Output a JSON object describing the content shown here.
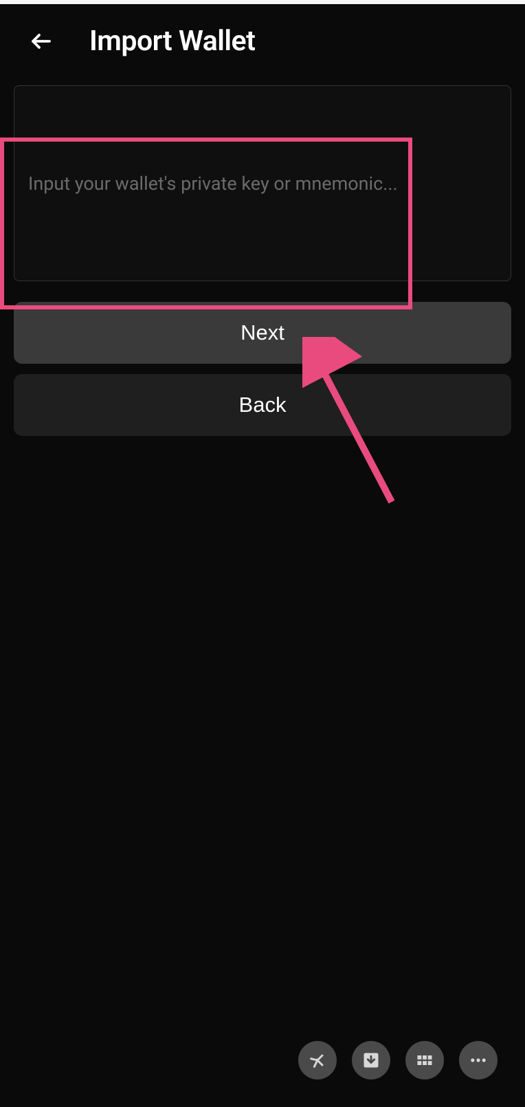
{
  "header": {
    "title": "Import Wallet"
  },
  "input": {
    "placeholder": "Input your wallet's private key or mnemonic..."
  },
  "buttons": {
    "next_label": "Next",
    "back_label": "Back"
  },
  "annotations": {
    "highlight_color": "#e94b7f",
    "arrow_color": "#e94b7f"
  }
}
